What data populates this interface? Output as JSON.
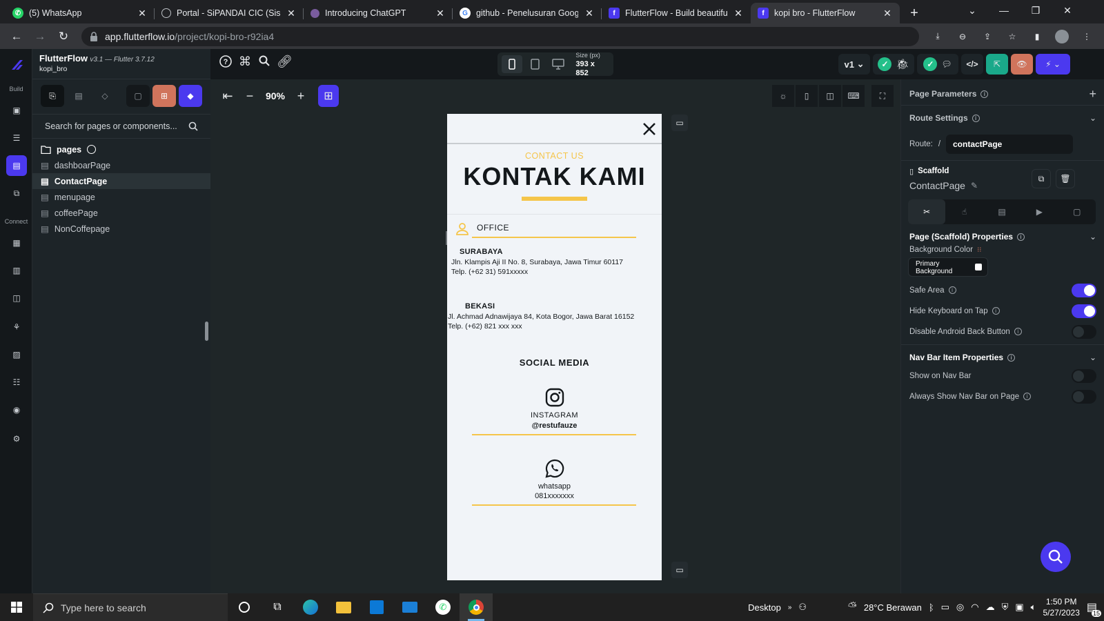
{
  "browser": {
    "tabs": [
      {
        "title": "(5) WhatsApp",
        "fav": "whatsapp-icon",
        "color": "#25d366",
        "active": false
      },
      {
        "title": "Portal - SiPANDAI CIC (Sistem",
        "fav": "globe-icon",
        "color": "#5f6368",
        "active": false
      },
      {
        "title": "Introducing ChatGPT",
        "fav": "openai-icon",
        "color": "#7a5c9e",
        "active": false
      },
      {
        "title": "github - Penelusuran Google",
        "fav": "google-icon",
        "color": "#ffffff",
        "active": false
      },
      {
        "title": "FlutterFlow - Build beautiful, r",
        "fav": "flutterflow-icon",
        "color": "#4b39ef",
        "active": false
      },
      {
        "title": "kopi bro - FlutterFlow",
        "fav": "flutterflow-icon",
        "color": "#4b39ef",
        "active": true
      }
    ],
    "url_domain": "app.flutterflow.io",
    "url_path": "/project/kopi-bro-r92ia4"
  },
  "app": {
    "brand": "FlutterFlow",
    "version": "v3.1 — Flutter 3.7.12",
    "project": "kopi_bro",
    "rail_build": "Build",
    "rail_connect": "Connect",
    "search_placeholder": "Search for pages or components...",
    "pages_folder": "pages",
    "pages": [
      "dashboarPage",
      "ContactPage",
      "menupage",
      "coffeePage",
      "NonCoffepage"
    ],
    "selected_page": "ContactPage",
    "zoom": "90%",
    "device_size_label": "Size (px)",
    "device_size": "393 x 852",
    "version_select": "v1"
  },
  "phone": {
    "subtitle": "CONTACT US",
    "title": "KONTAK KAMI",
    "office": "OFFICE",
    "branch1_name": "SURABAYA",
    "branch1_addr": "Jln. Klampis Aji II No. 8, Surabaya, Jawa Timur 60117",
    "branch1_tel": "Telp. (+62 31) 591xxxxx",
    "branch2_name": "BEKASI",
    "branch2_addr": "Jl. Achmad Adnawijaya 84, Kota Bogor, Jawa Barat 16152",
    "branch2_tel": "Telp. (+62) 821 xxx xxx",
    "social_title": "SOCIAL MEDIA",
    "ig_label": "INSTAGRAM",
    "ig_handle": "@restufauze",
    "wa_label": "whatsapp",
    "wa_number": "081xxxxxxx",
    "accent": "#f5c54a"
  },
  "props": {
    "page_parameters": "Page Parameters",
    "route_settings": "Route Settings",
    "route_label": "Route:",
    "route_slash": "/",
    "route_value": "contactPage",
    "widget_type": "Scaffold",
    "widget_name": "ContactPage",
    "scaffold_props": "Page (Scaffold) Properties",
    "bg_color_label": "Background Color",
    "bg_color_value_1": "Primary",
    "bg_color_value_2": "Background",
    "safe_area": "Safe Area",
    "hide_keyboard": "Hide Keyboard on Tap",
    "disable_back": "Disable Android Back Button",
    "navbar_props": "Nav Bar Item Properties",
    "show_nav": "Show on Nav Bar",
    "always_nav": "Always Show Nav Bar on Page",
    "safe_area_on": true,
    "hide_keyboard_on": true,
    "disable_back_on": false,
    "show_nav_on": false,
    "always_nav_on": false
  },
  "taskbar": {
    "search_placeholder": "Type here to search",
    "desktop": "Desktop",
    "weather": "28°C  Berawan",
    "time": "1:50 PM",
    "date": "5/27/2023",
    "notifications": "15"
  }
}
